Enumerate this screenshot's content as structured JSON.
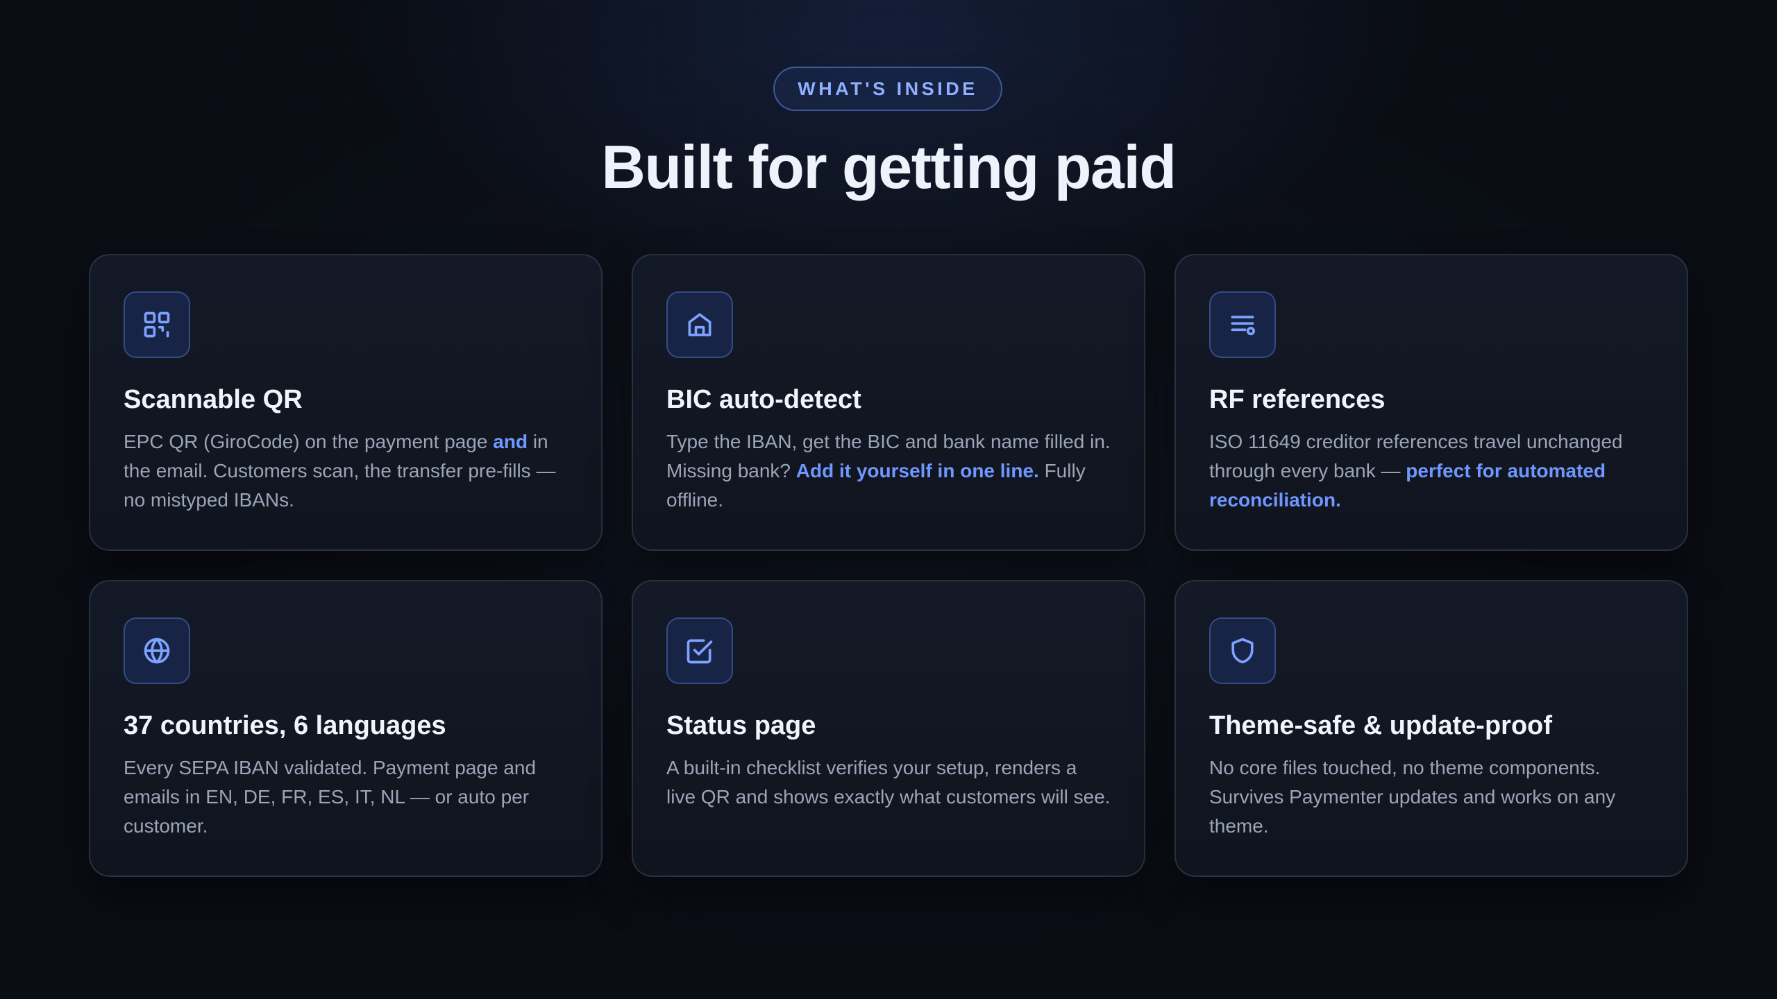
{
  "section": {
    "eyebrow": "WHAT'S INSIDE",
    "title": "Built for getting paid"
  },
  "colors": {
    "background": "#0a0d14",
    "card": "#131926",
    "accent": "#6f97ff",
    "icon_bg": "#172445",
    "text": "#f1f4fb",
    "muted": "#9aa5b8"
  },
  "features": [
    {
      "icon": "qr-code-icon",
      "title": "Scannable QR",
      "desc_1": "EPC QR (GiroCode) on the payment page ",
      "highlight": "and",
      "desc_2": " in the email. Customers scan, the transfer pre-fills — no mistyped IBANs."
    },
    {
      "icon": "bank-icon",
      "title": "BIC auto-detect",
      "desc_1": "Type the IBAN, get the BIC and bank name filled in. Missing bank? ",
      "highlight": "Add it yourself in one line.",
      "desc_2": " Fully offline."
    },
    {
      "icon": "reference-list-icon",
      "title": "RF references",
      "desc_1": "ISO 11649 creditor references travel unchanged through every bank — ",
      "highlight": "perfect for automated reconciliation.",
      "desc_2": ""
    },
    {
      "icon": "globe-icon",
      "title": "37 countries, 6 languages",
      "desc_1": "Every SEPA IBAN validated. Payment page and emails in EN, DE, FR, ES, IT, NL — or auto per customer.",
      "highlight": "",
      "desc_2": ""
    },
    {
      "icon": "checkbox-icon",
      "title": "Status page",
      "desc_1": "A built-in checklist verifies your setup, renders a live QR and shows exactly what customers will see.",
      "highlight": "",
      "desc_2": ""
    },
    {
      "icon": "shield-icon",
      "title": "Theme-safe & update-proof",
      "desc_1": "No core files touched, no theme components. Survives Paymenter updates and works on any theme.",
      "highlight": "",
      "desc_2": ""
    }
  ]
}
